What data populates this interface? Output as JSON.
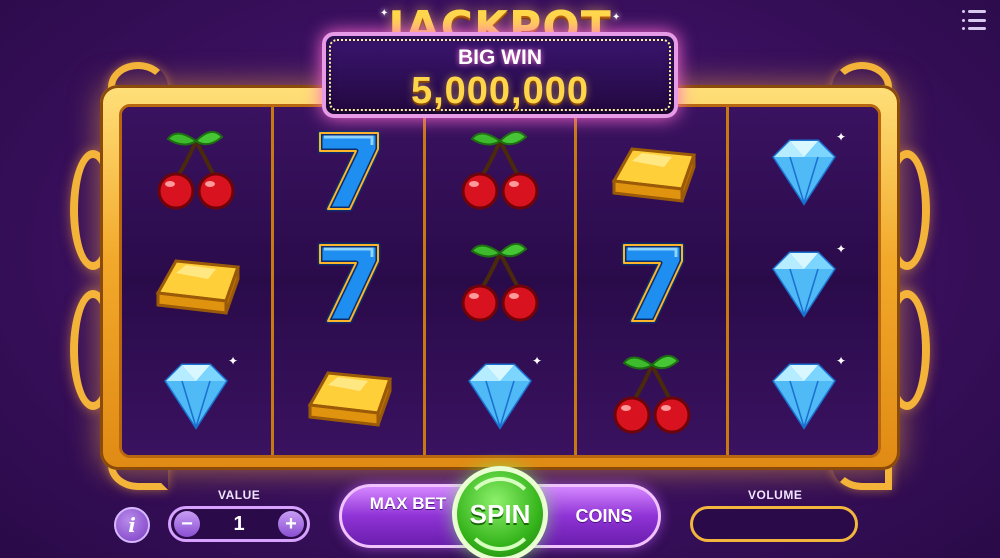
{
  "header": {
    "jackpot_title": "JACKPOT",
    "big_win_label": "BIG WIN",
    "jackpot_amount": "5,000,000"
  },
  "menu": {
    "icon": "list-menu-icon"
  },
  "reels": [
    [
      "cherry",
      "gold-bar",
      "diamond"
    ],
    [
      "seven",
      "seven",
      "gold-bar"
    ],
    [
      "cherry",
      "cherry",
      "diamond"
    ],
    [
      "gold-bar",
      "seven",
      "cherry"
    ],
    [
      "diamond",
      "diamond",
      "diamond"
    ]
  ],
  "controls": {
    "value_label": "VALUE",
    "value": "1",
    "minus": "−",
    "plus": "+",
    "info": "i",
    "max_bet": "MAX BET",
    "spin": "SPIN",
    "coins": "COINS",
    "volume_label": "VOLUME"
  },
  "colors": {
    "background": "#3d1163",
    "frame_gold": "#f2a92b",
    "jackpot_gold": "#ffd84a",
    "spin_green": "#36b51c",
    "action_purple": "#8f33d6"
  }
}
